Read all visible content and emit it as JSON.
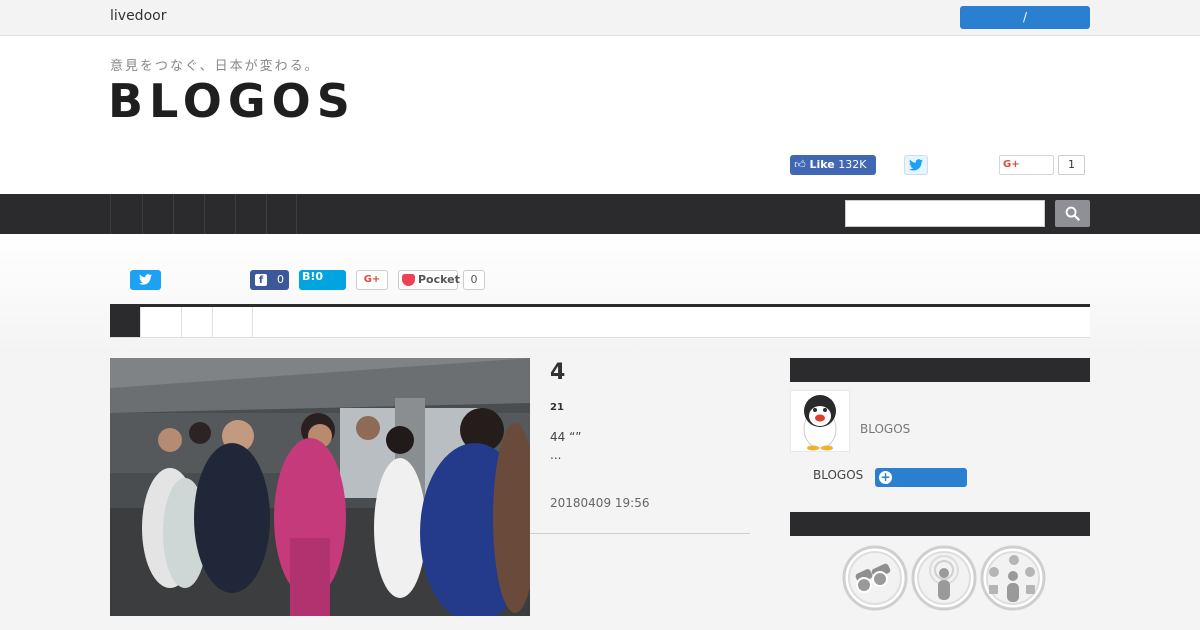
{
  "topbar": {
    "brand": "livedoor",
    "login_label": "/"
  },
  "header": {
    "tagline": "意見をつなぐ、日本が変わる。",
    "logo": "BLOGOS",
    "fb_like_label": "Like",
    "fb_like_count": "132K",
    "gplus_label": "G+",
    "gplus_count": "1"
  },
  "search": {
    "placeholder": ""
  },
  "share": {
    "facebook_count": "0",
    "hatena_label": "B!",
    "hatena_count": "0",
    "gplus_label": "G+",
    "pocket_label": "Pocket",
    "pocket_count": "0"
  },
  "article": {
    "number": "4",
    "sub": "21",
    "excerpt": "44 “”",
    "ellipsis": "...",
    "date": "20180409 19:56"
  },
  "sidebar": {
    "author_name": "BLOGOS",
    "label": "BLOGOS"
  },
  "colors": {
    "nav_dark": "#2b2b2d",
    "accent_blue": "#2b7fd0",
    "facebook": "#3b5998",
    "twitter": "#1da1f2",
    "hatena": "#00a4de",
    "pocket": "#ef4056"
  }
}
